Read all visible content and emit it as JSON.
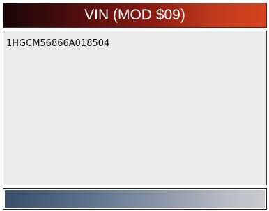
{
  "header": {
    "title": "VIN (MOD $09)"
  },
  "main": {
    "vin_value": "1HGCM56866A018504"
  },
  "colors": {
    "title_gradient_start": "#1a0606",
    "title_gradient_end": "#d6431f",
    "content_background": "#ebebeb",
    "footer_gradient_start": "#3a4f6c",
    "footer_gradient_end": "#c9cbd0"
  }
}
